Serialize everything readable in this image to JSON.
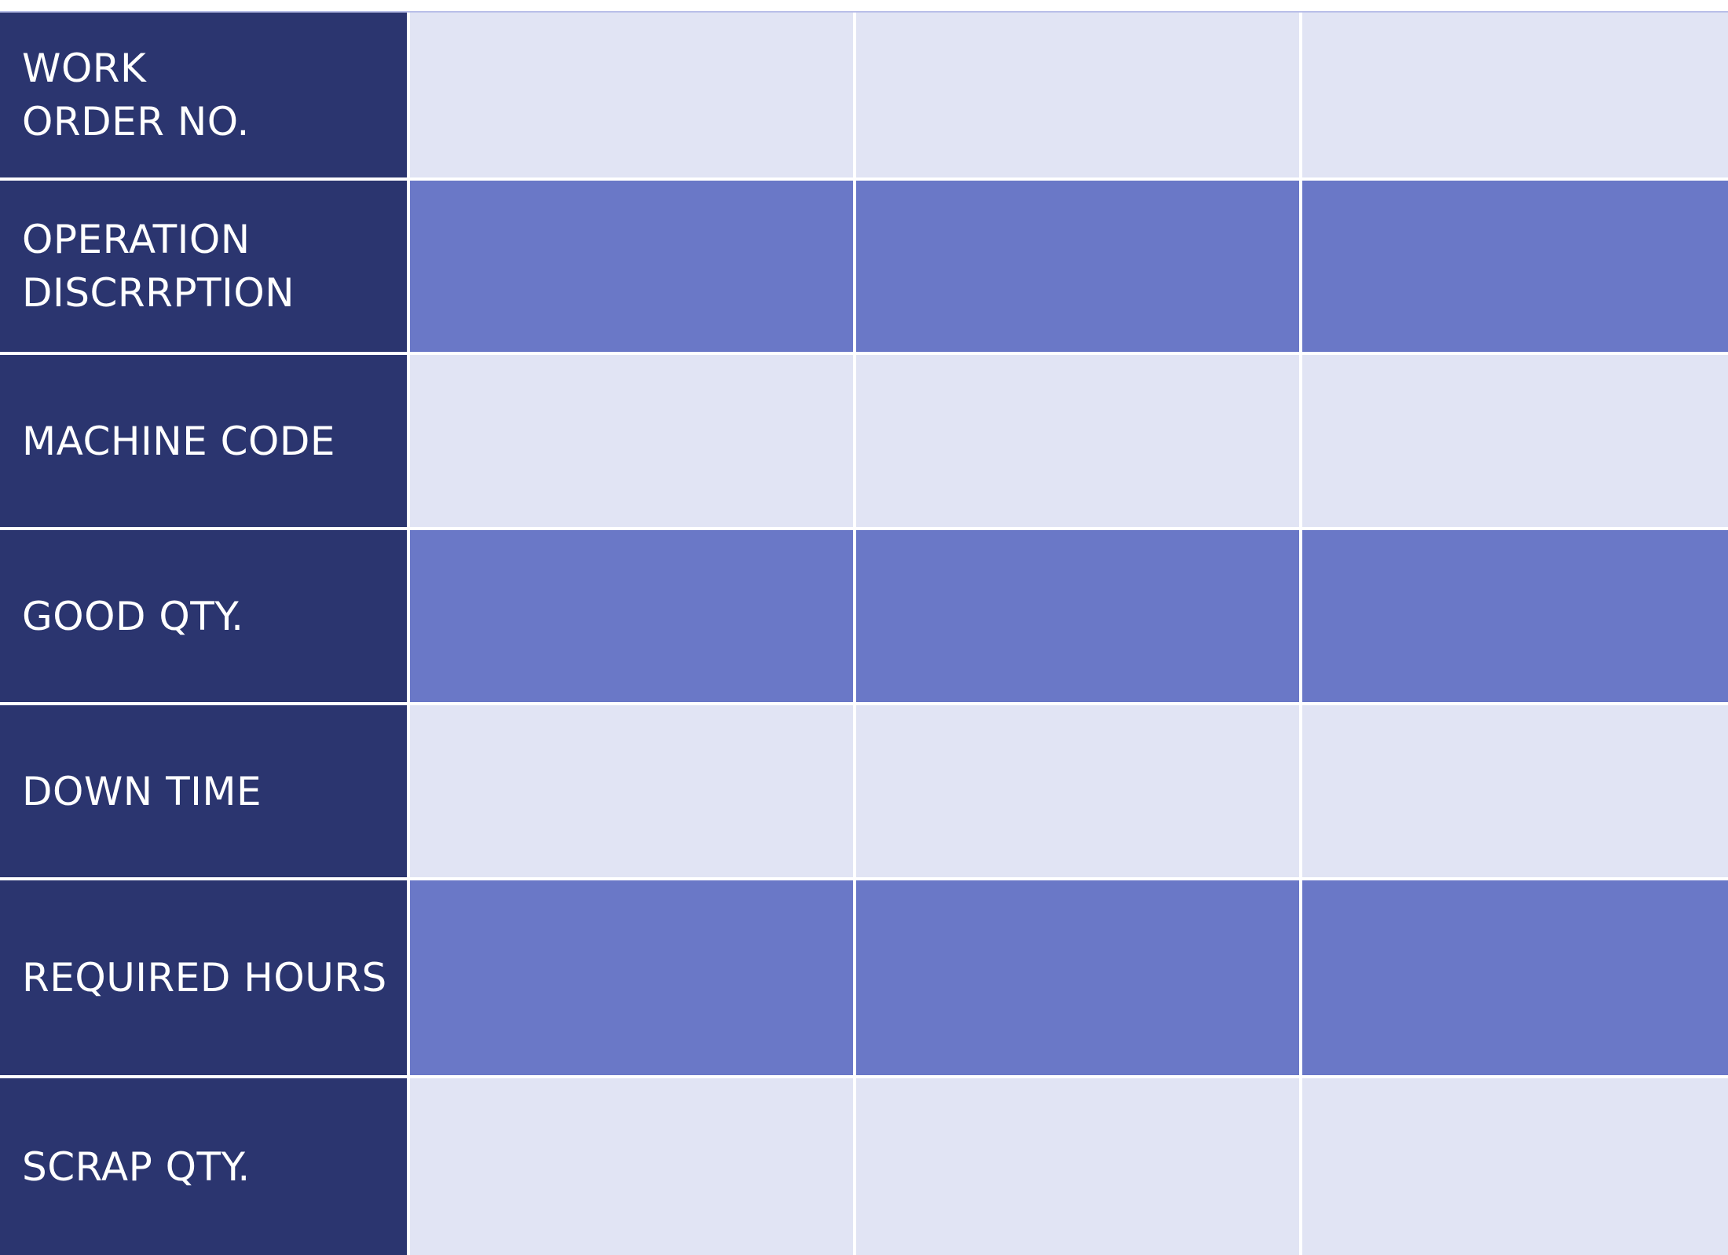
{
  "table": {
    "rows": [
      {
        "label": "WORK\nORDER NO.",
        "shade": "light",
        "values": [
          "",
          "",
          ""
        ]
      },
      {
        "label": "OPERATION\nDISCRRPTION",
        "shade": "dark",
        "values": [
          "",
          "",
          ""
        ]
      },
      {
        "label": "MACHINE CODE",
        "shade": "light",
        "values": [
          "",
          "",
          ""
        ]
      },
      {
        "label": "GOOD QTY.",
        "shade": "dark",
        "values": [
          "",
          "",
          ""
        ]
      },
      {
        "label": "DOWN TIME",
        "shade": "light",
        "values": [
          "",
          "",
          ""
        ]
      },
      {
        "label": "REQUIRED HOURS",
        "shade": "dark",
        "values": [
          "",
          "",
          ""
        ]
      },
      {
        "label": "SCRAP QTY.",
        "shade": "light",
        "values": [
          "",
          "",
          ""
        ]
      }
    ]
  },
  "colors": {
    "label_background": "#2b356f",
    "label_text": "#ffffff",
    "light_cell": "#e1e4f4",
    "dark_cell": "#6a78c7",
    "grid_line": "#ffffff"
  }
}
